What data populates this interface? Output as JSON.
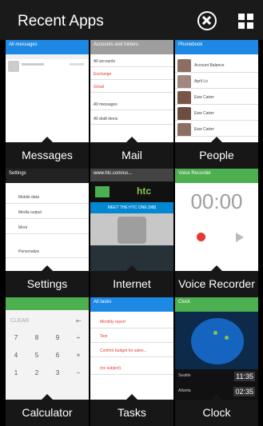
{
  "header": {
    "title": "Recent Apps"
  },
  "tiles": [
    {
      "label": "Messages"
    },
    {
      "label": "Mail"
    },
    {
      "label": "People"
    },
    {
      "label": "Settings"
    },
    {
      "label": "Internet"
    },
    {
      "label": "Voice Recorder"
    },
    {
      "label": "Calculator"
    },
    {
      "label": "Tasks"
    },
    {
      "label": "Clock"
    }
  ],
  "messages": {
    "bar_title": "All messages"
  },
  "mail": {
    "bar_title": "Accounts and folders",
    "rows": [
      "All accounts",
      "Exchange",
      "Gmail",
      "All messages",
      "All draft items"
    ]
  },
  "people": {
    "bar_title": "Phonebook",
    "contacts": [
      "Account Balance",
      "April Lo",
      "Ewe Carter",
      "Ewe Carter",
      "Ewe Carter"
    ]
  },
  "settings": {
    "bar_title": "Settings",
    "rows": [
      "Mobile data",
      "Media output",
      "More",
      "Personalize"
    ]
  },
  "internet": {
    "url": "www.htc.com/us...",
    "logo": "htc",
    "banner": "MEET THE HTC ONE (M8)"
  },
  "voice": {
    "bar_title": "Voice Recorder",
    "timer": "00:00"
  },
  "calculator": {
    "clear": "CLEAR",
    "keys": [
      "7",
      "8",
      "9",
      "4",
      "5",
      "6",
      "1",
      "2",
      "3"
    ]
  },
  "tasks": {
    "bar_title": "All tasks",
    "items": [
      "Monthly report",
      "Test",
      "Confirm budget for sales...",
      "(no subject)"
    ]
  },
  "clock": {
    "bar_title": "Clock",
    "cities": [
      {
        "name": "Seattle",
        "time": "11:35"
      },
      {
        "name": "Atlanta",
        "time": "02:35"
      }
    ]
  },
  "colors": {
    "accent_blue": "#1e88e5",
    "record_red": "#e53935"
  }
}
